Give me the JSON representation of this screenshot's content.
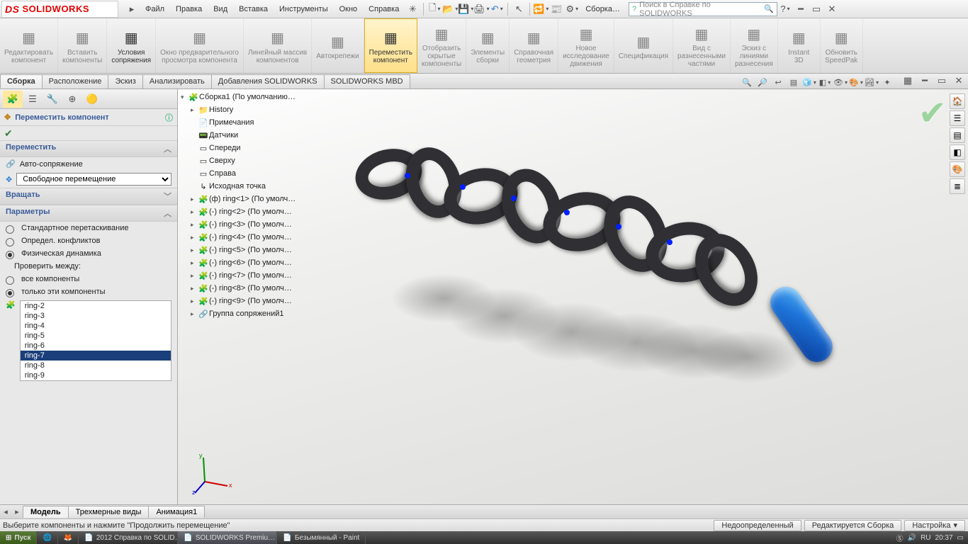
{
  "app": {
    "brand": "SOLIDWORKS",
    "title_crumb": "Сборка…"
  },
  "menu": [
    "Файл",
    "Правка",
    "Вид",
    "Вставка",
    "Инструменты",
    "Окно",
    "Справка"
  ],
  "search": {
    "placeholder": "Поиск в Справке по SOLIDWORKS"
  },
  "ribbon": [
    {
      "label": "Редактировать\nкомпонент",
      "enabled": false
    },
    {
      "label": "Вставить\nкомпоненты",
      "enabled": false
    },
    {
      "label": "Условия\nсопряжения",
      "enabled": true
    },
    {
      "label": "Окно предварительного\nпросмотра компонента",
      "enabled": false
    },
    {
      "label": "Линейный массив\nкомпонентов",
      "enabled": false
    },
    {
      "label": "Автокрепежи",
      "enabled": false
    },
    {
      "label": "Переместить\nкомпонент",
      "enabled": true,
      "active": true
    },
    {
      "label": "Отобразить\nскрытые\nкомпоненты",
      "enabled": false
    },
    {
      "label": "Элементы\nсборки",
      "enabled": false
    },
    {
      "label": "Справочная\nгеометрия",
      "enabled": false
    },
    {
      "label": "Новое\nисследование\nдвижения",
      "enabled": false
    },
    {
      "label": "Спецификация",
      "enabled": false
    },
    {
      "label": "Вид с\nразнесенными\nчастями",
      "enabled": false
    },
    {
      "label": "Эскиз с\nлиниями\nразнесения",
      "enabled": false
    },
    {
      "label": "Instant\n3D",
      "enabled": false
    },
    {
      "label": "Обновить\nSpeedPak",
      "enabled": false
    }
  ],
  "tabs": [
    "Сборка",
    "Расположение",
    "Эскиз",
    "Анализировать",
    "Добавления SOLIDWORKS",
    "SOLIDWORKS MBD"
  ],
  "active_tab": 0,
  "pm": {
    "title": "Переместить компонент",
    "sec_move": "Переместить",
    "row_auto": "Авто-сопряжение",
    "combo": "Свободное перемещение",
    "sec_rotate": "Вращать",
    "sec_params": "Параметры",
    "opt_std": "Стандартное перетаскивание",
    "opt_conf": "Определ. конфликтов",
    "opt_phys": "Физическая динамика",
    "check_label": "Проверить между:",
    "opt_all": "все компоненты",
    "opt_only": "только эти компоненты",
    "list": [
      "ring-2",
      "ring-3",
      "ring-4",
      "ring-5",
      "ring-6",
      "ring-7",
      "ring-8",
      "ring-9"
    ],
    "selected": "ring-7"
  },
  "tree": {
    "root": "Сборка1  (По умолчанию…",
    "items": [
      {
        "icon": "📁",
        "label": "History",
        "exp": "▸"
      },
      {
        "icon": "📄",
        "label": "Примечания"
      },
      {
        "icon": "📟",
        "label": "Датчики"
      },
      {
        "icon": "▭",
        "label": "Спереди"
      },
      {
        "icon": "▭",
        "label": "Сверху"
      },
      {
        "icon": "▭",
        "label": "Справа"
      },
      {
        "icon": "↳",
        "label": "Исходная точка"
      },
      {
        "icon": "🧩",
        "label": "(ф) ring<1> (По умолч…",
        "exp": "▸"
      },
      {
        "icon": "🧩",
        "label": "(-) ring<2> (По умолч…",
        "exp": "▸"
      },
      {
        "icon": "🧩",
        "label": "(-) ring<3> (По умолч…",
        "exp": "▸"
      },
      {
        "icon": "🧩",
        "label": "(-) ring<4> (По умолч…",
        "exp": "▸"
      },
      {
        "icon": "🧩",
        "label": "(-) ring<5> (По умолч…",
        "exp": "▸"
      },
      {
        "icon": "🧩",
        "label": "(-) ring<6> (По умолч…",
        "exp": "▸"
      },
      {
        "icon": "🧩",
        "label": "(-) ring<7> (По умолч…",
        "exp": "▸"
      },
      {
        "icon": "🧩",
        "label": "(-) ring<8> (По умолч…",
        "exp": "▸"
      },
      {
        "icon": "🧩",
        "label": "(-) ring<9> (По умолч…",
        "exp": "▸"
      },
      {
        "icon": "🔗",
        "label": "Группа сопряжений1",
        "exp": "▸"
      }
    ]
  },
  "bottom_tabs": [
    "Модель",
    "Трехмерные виды",
    "Анимация1"
  ],
  "status": {
    "prompt": "Выберите компоненты и нажмите \"Продолжить перемещение\"",
    "under": "Недоопределенный",
    "mode": "Редактируется Сборка",
    "custom": "Настройка"
  },
  "taskbar": {
    "start": "Пуск",
    "items": [
      "2012 Справка по SOLID…",
      "SOLIDWORKS Premiu…",
      "Безымянный - Paint"
    ],
    "lang": "RU",
    "time": "20:37"
  }
}
